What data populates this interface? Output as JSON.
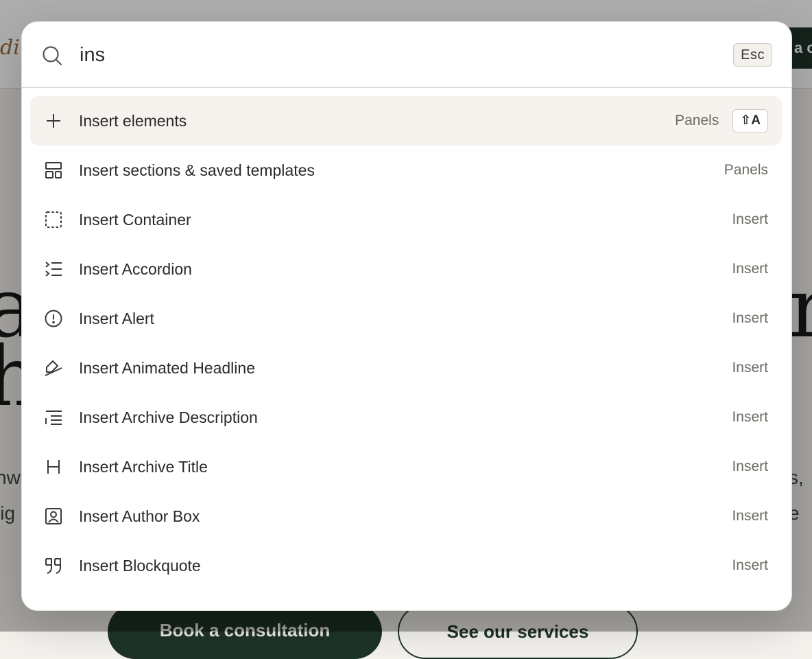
{
  "background": {
    "logo_fragment": "di",
    "cta_fragment": "a c",
    "heading_left": "a\nh",
    "heading_right": "r",
    "para_left": "nw\nlig",
    "para_right": "s,\ne",
    "primary_button": "Book a consultation",
    "secondary_button": "See our services"
  },
  "search": {
    "value": "ins",
    "placeholder": "",
    "esc_label": "Esc"
  },
  "items": [
    {
      "icon": "plus-icon",
      "label": "Insert elements",
      "category": "Panels",
      "shortcut": "⇧A"
    },
    {
      "icon": "layout-templates-icon",
      "label": "Insert sections & saved templates",
      "category": "Panels"
    },
    {
      "icon": "container-dashed-icon",
      "label": "Insert Container",
      "category": "Insert"
    },
    {
      "icon": "accordion-list-icon",
      "label": "Insert Accordion",
      "category": "Insert"
    },
    {
      "icon": "alert-circle-icon",
      "label": "Insert Alert",
      "category": "Insert"
    },
    {
      "icon": "highlighter-icon",
      "label": "Insert Animated Headline",
      "category": "Insert"
    },
    {
      "icon": "text-description-icon",
      "label": "Insert Archive Description",
      "category": "Insert"
    },
    {
      "icon": "heading-h-icon",
      "label": "Insert Archive Title",
      "category": "Insert"
    },
    {
      "icon": "author-box-icon",
      "label": "Insert Author Box",
      "category": "Insert"
    },
    {
      "icon": "blockquote-icon",
      "label": "Insert Blockquote",
      "category": "Insert"
    }
  ],
  "colors": {
    "accent_dark_green": "#1e3328",
    "active_row_bg": "#f6f2ee",
    "text": "#2a2a2a",
    "muted_text": "#6e6a64"
  }
}
